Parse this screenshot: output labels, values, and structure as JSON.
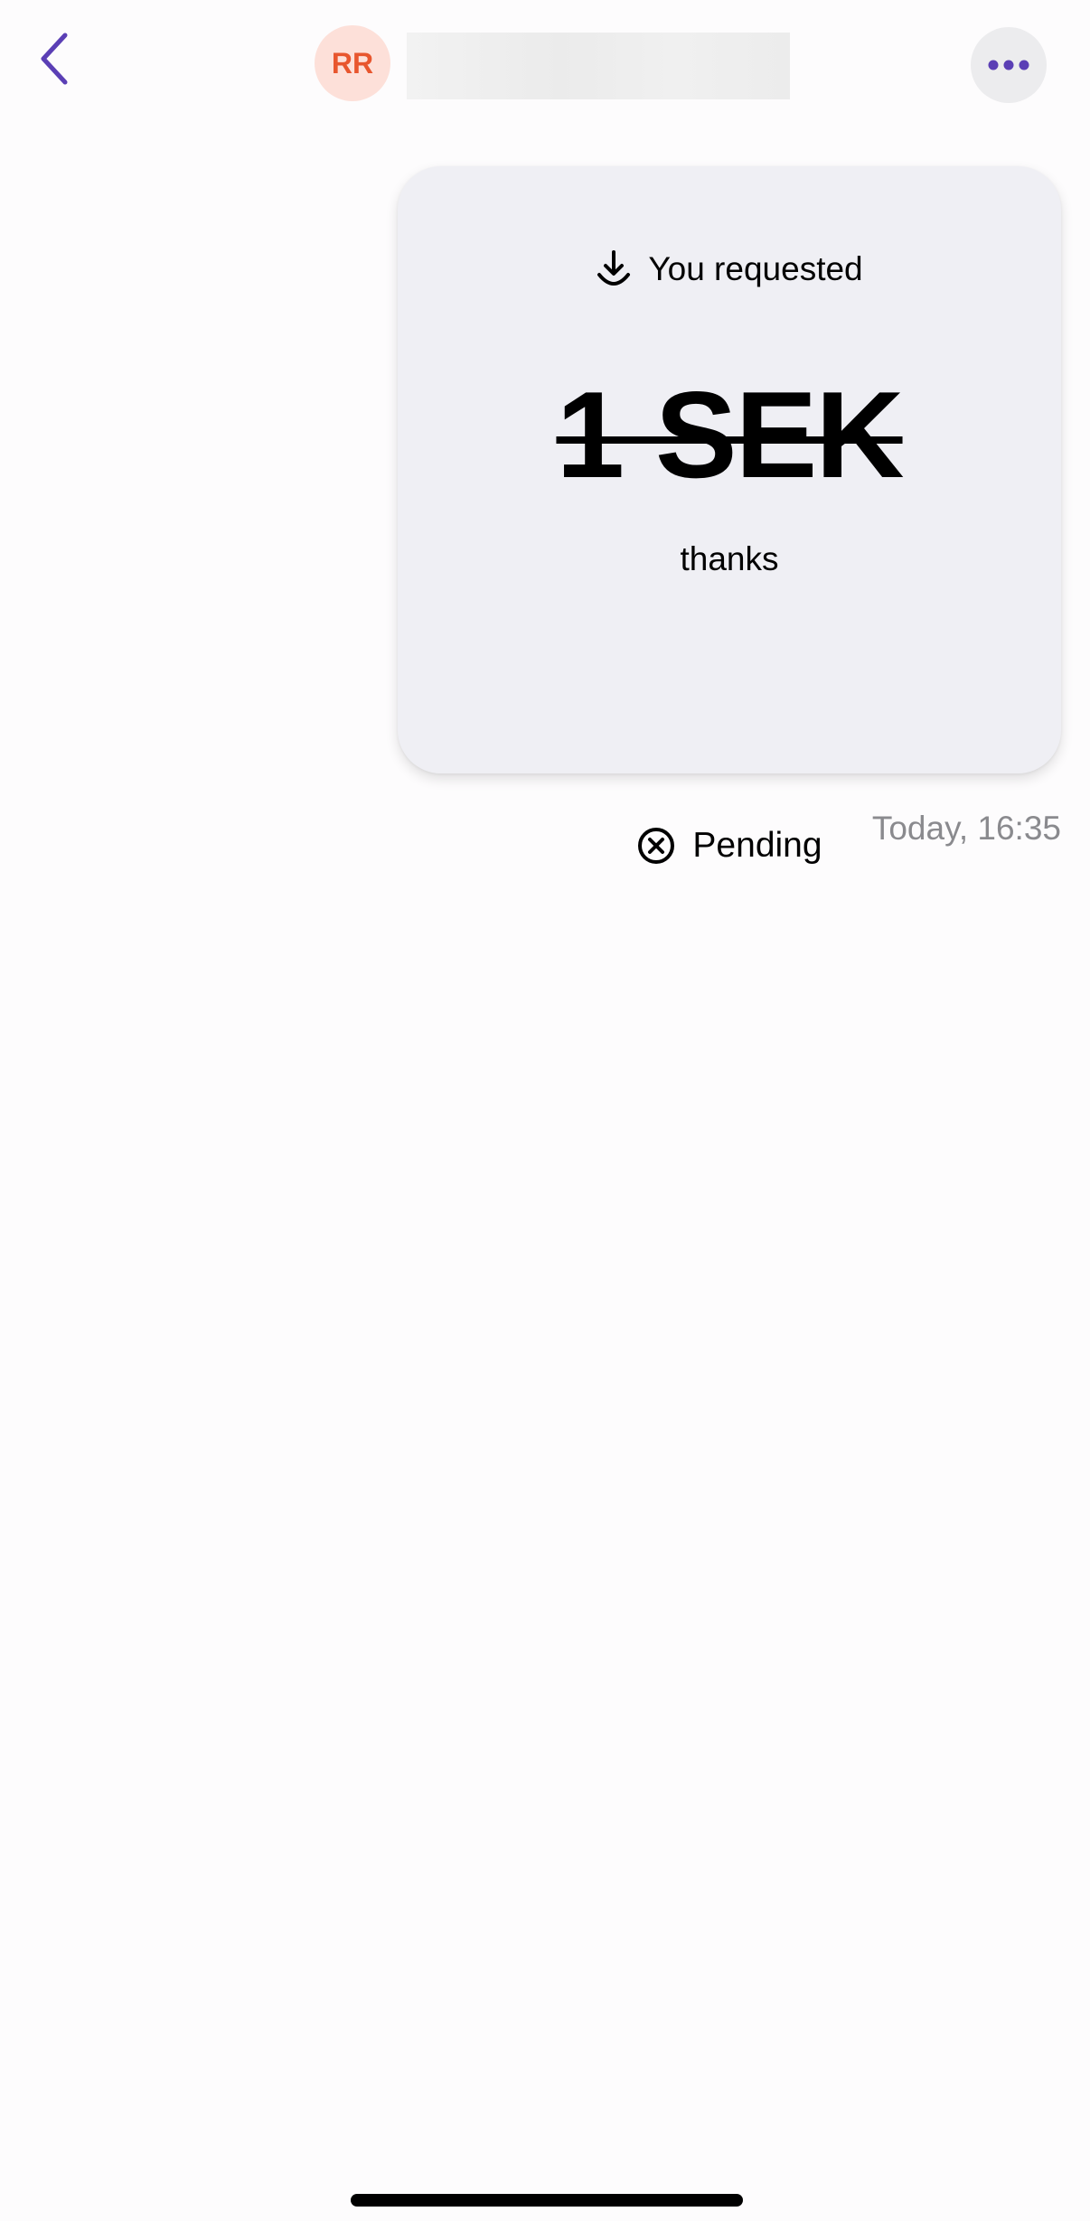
{
  "header": {
    "avatar_initials": "RR",
    "contact_name": ""
  },
  "request": {
    "direction_label": "You requested",
    "amount": "1 SEK",
    "message": "thanks",
    "status": "Pending",
    "timestamp": "Today, 16:35"
  },
  "icons": {
    "back": "chevron-left-icon",
    "more": "ellipsis-icon",
    "direction": "download-arrow-icon",
    "status": "circle-x-icon"
  },
  "colors": {
    "accent": "#5b3fb5",
    "avatar_bg": "#fde0d9",
    "avatar_text": "#e8562e",
    "card_bg": "#efeff4",
    "timestamp": "#8a8a8e"
  }
}
